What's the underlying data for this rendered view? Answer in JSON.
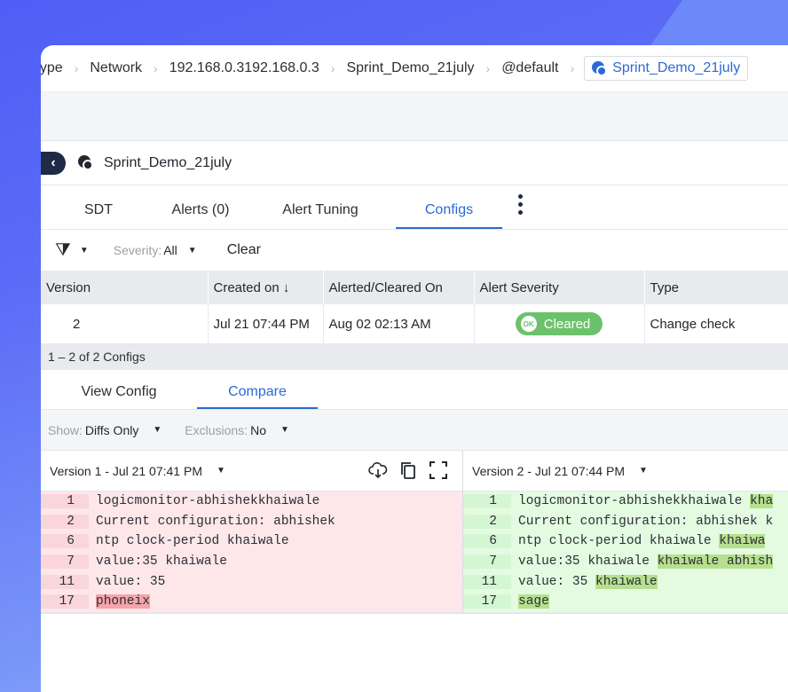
{
  "breadcrumb": {
    "items": [
      "Type",
      "Network",
      "192.168.0.3192.168.0.3",
      "Sprint_Demo_21july",
      "@default"
    ],
    "active": "Sprint_Demo_21july"
  },
  "resource": {
    "name": "Sprint_Demo_21july",
    "icon": "resource-icon"
  },
  "tabs": [
    {
      "label": "SDT"
    },
    {
      "label": "Alerts (0)"
    },
    {
      "label": "Alert Tuning"
    },
    {
      "label": "Configs",
      "active": true
    }
  ],
  "filter": {
    "severity_label": "Severity:",
    "severity_value": "All",
    "clear": "Clear"
  },
  "table": {
    "headers": [
      "Version",
      "Created on ↓",
      "Alerted/Cleared On",
      "Alert Severity",
      "Type"
    ],
    "rows": [
      {
        "version": "2",
        "created": "Jul 21 07:44 PM",
        "alerted": "Aug 02 02:13 AM",
        "severity_badge": "OK",
        "severity": "Cleared",
        "type": "Change check"
      }
    ],
    "pager": "1 – 2 of 2 Configs"
  },
  "subtabs": [
    {
      "label": "View Config"
    },
    {
      "label": "Compare",
      "active": true
    }
  ],
  "show": {
    "show_label": "Show:",
    "show_value": "Diffs Only",
    "excl_label": "Exclusions:",
    "excl_value": "No"
  },
  "compare": {
    "left_label": "Version 1 - Jul 21 07:41 PM",
    "right_label": "Version 2 - Jul 21 07:44 PM",
    "left_lines": [
      {
        "n": "1",
        "text": "logicmonitor-abhishekkhaiwale",
        "del": ""
      },
      {
        "n": "2",
        "text": "Current configuration: abhishek",
        "del": ""
      },
      {
        "n": "6",
        "text": "ntp clock-period khaiwale",
        "del": ""
      },
      {
        "n": "7",
        "text": "value:35 khaiwale",
        "del": ""
      },
      {
        "n": "11",
        "text": "value: 35",
        "del": ""
      },
      {
        "n": "17",
        "text": "",
        "del": "phoneix"
      }
    ],
    "right_lines": [
      {
        "n": "1",
        "text": "logicmonitor-abhishekkhaiwale ",
        "add": "kha"
      },
      {
        "n": "2",
        "text": "Current configuration: abhishek k",
        "add": ""
      },
      {
        "n": "6",
        "text": "ntp clock-period khaiwale ",
        "add": "khaiwa"
      },
      {
        "n": "7",
        "text": "value:35 khaiwale ",
        "add": "khaiwale abhish"
      },
      {
        "n": "11",
        "text": "value: 35 ",
        "add": "khaiwale"
      },
      {
        "n": "17",
        "text": "",
        "add": "sage"
      }
    ]
  },
  "colors": {
    "accent": "#2a6ad8",
    "cleared": "#6cc26a",
    "del_bg": "#fde7e9",
    "add_bg": "#e4fbe2"
  }
}
